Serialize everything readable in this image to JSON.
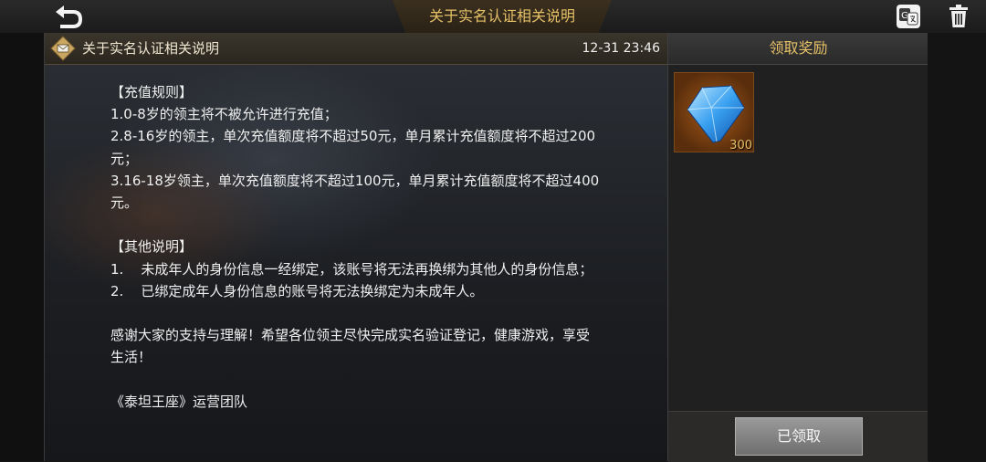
{
  "topbar": {
    "title": "关于实名认证相关说明"
  },
  "mail": {
    "subject": "关于实名认证相关说明",
    "time": "12-31 23:46",
    "body_lines": [
      "【充值规则】",
      "1.0-8岁的领主将不被允许进行充值；",
      "2.8-16岁的领主，单次充值额度将不超过50元，单月累计充值额度将不超过200",
      "元；",
      "3.16-18岁领主，单次充值额度将不超过100元，单月累计充值额度将不超过400",
      "元。",
      "",
      "【其他说明】",
      "1.    未成年人的身份信息一经绑定，该账号将无法再换绑为其他人的身份信息；",
      "2.    已绑定成年人身份信息的账号将无法换绑定为未成年人。",
      "",
      "感谢大家的支持与理解！希望各位领主尽快完成实名验证登记，健康游戏，享受",
      "生活！",
      "",
      "《泰坦王座》运营团队"
    ]
  },
  "reward": {
    "header": "领取奖励",
    "items": [
      {
        "icon": "diamond-icon",
        "quantity": "300"
      }
    ],
    "claimed_label": "已领取"
  },
  "colors": {
    "gold": "#e6c067",
    "diamond": "#2f8fe0"
  }
}
